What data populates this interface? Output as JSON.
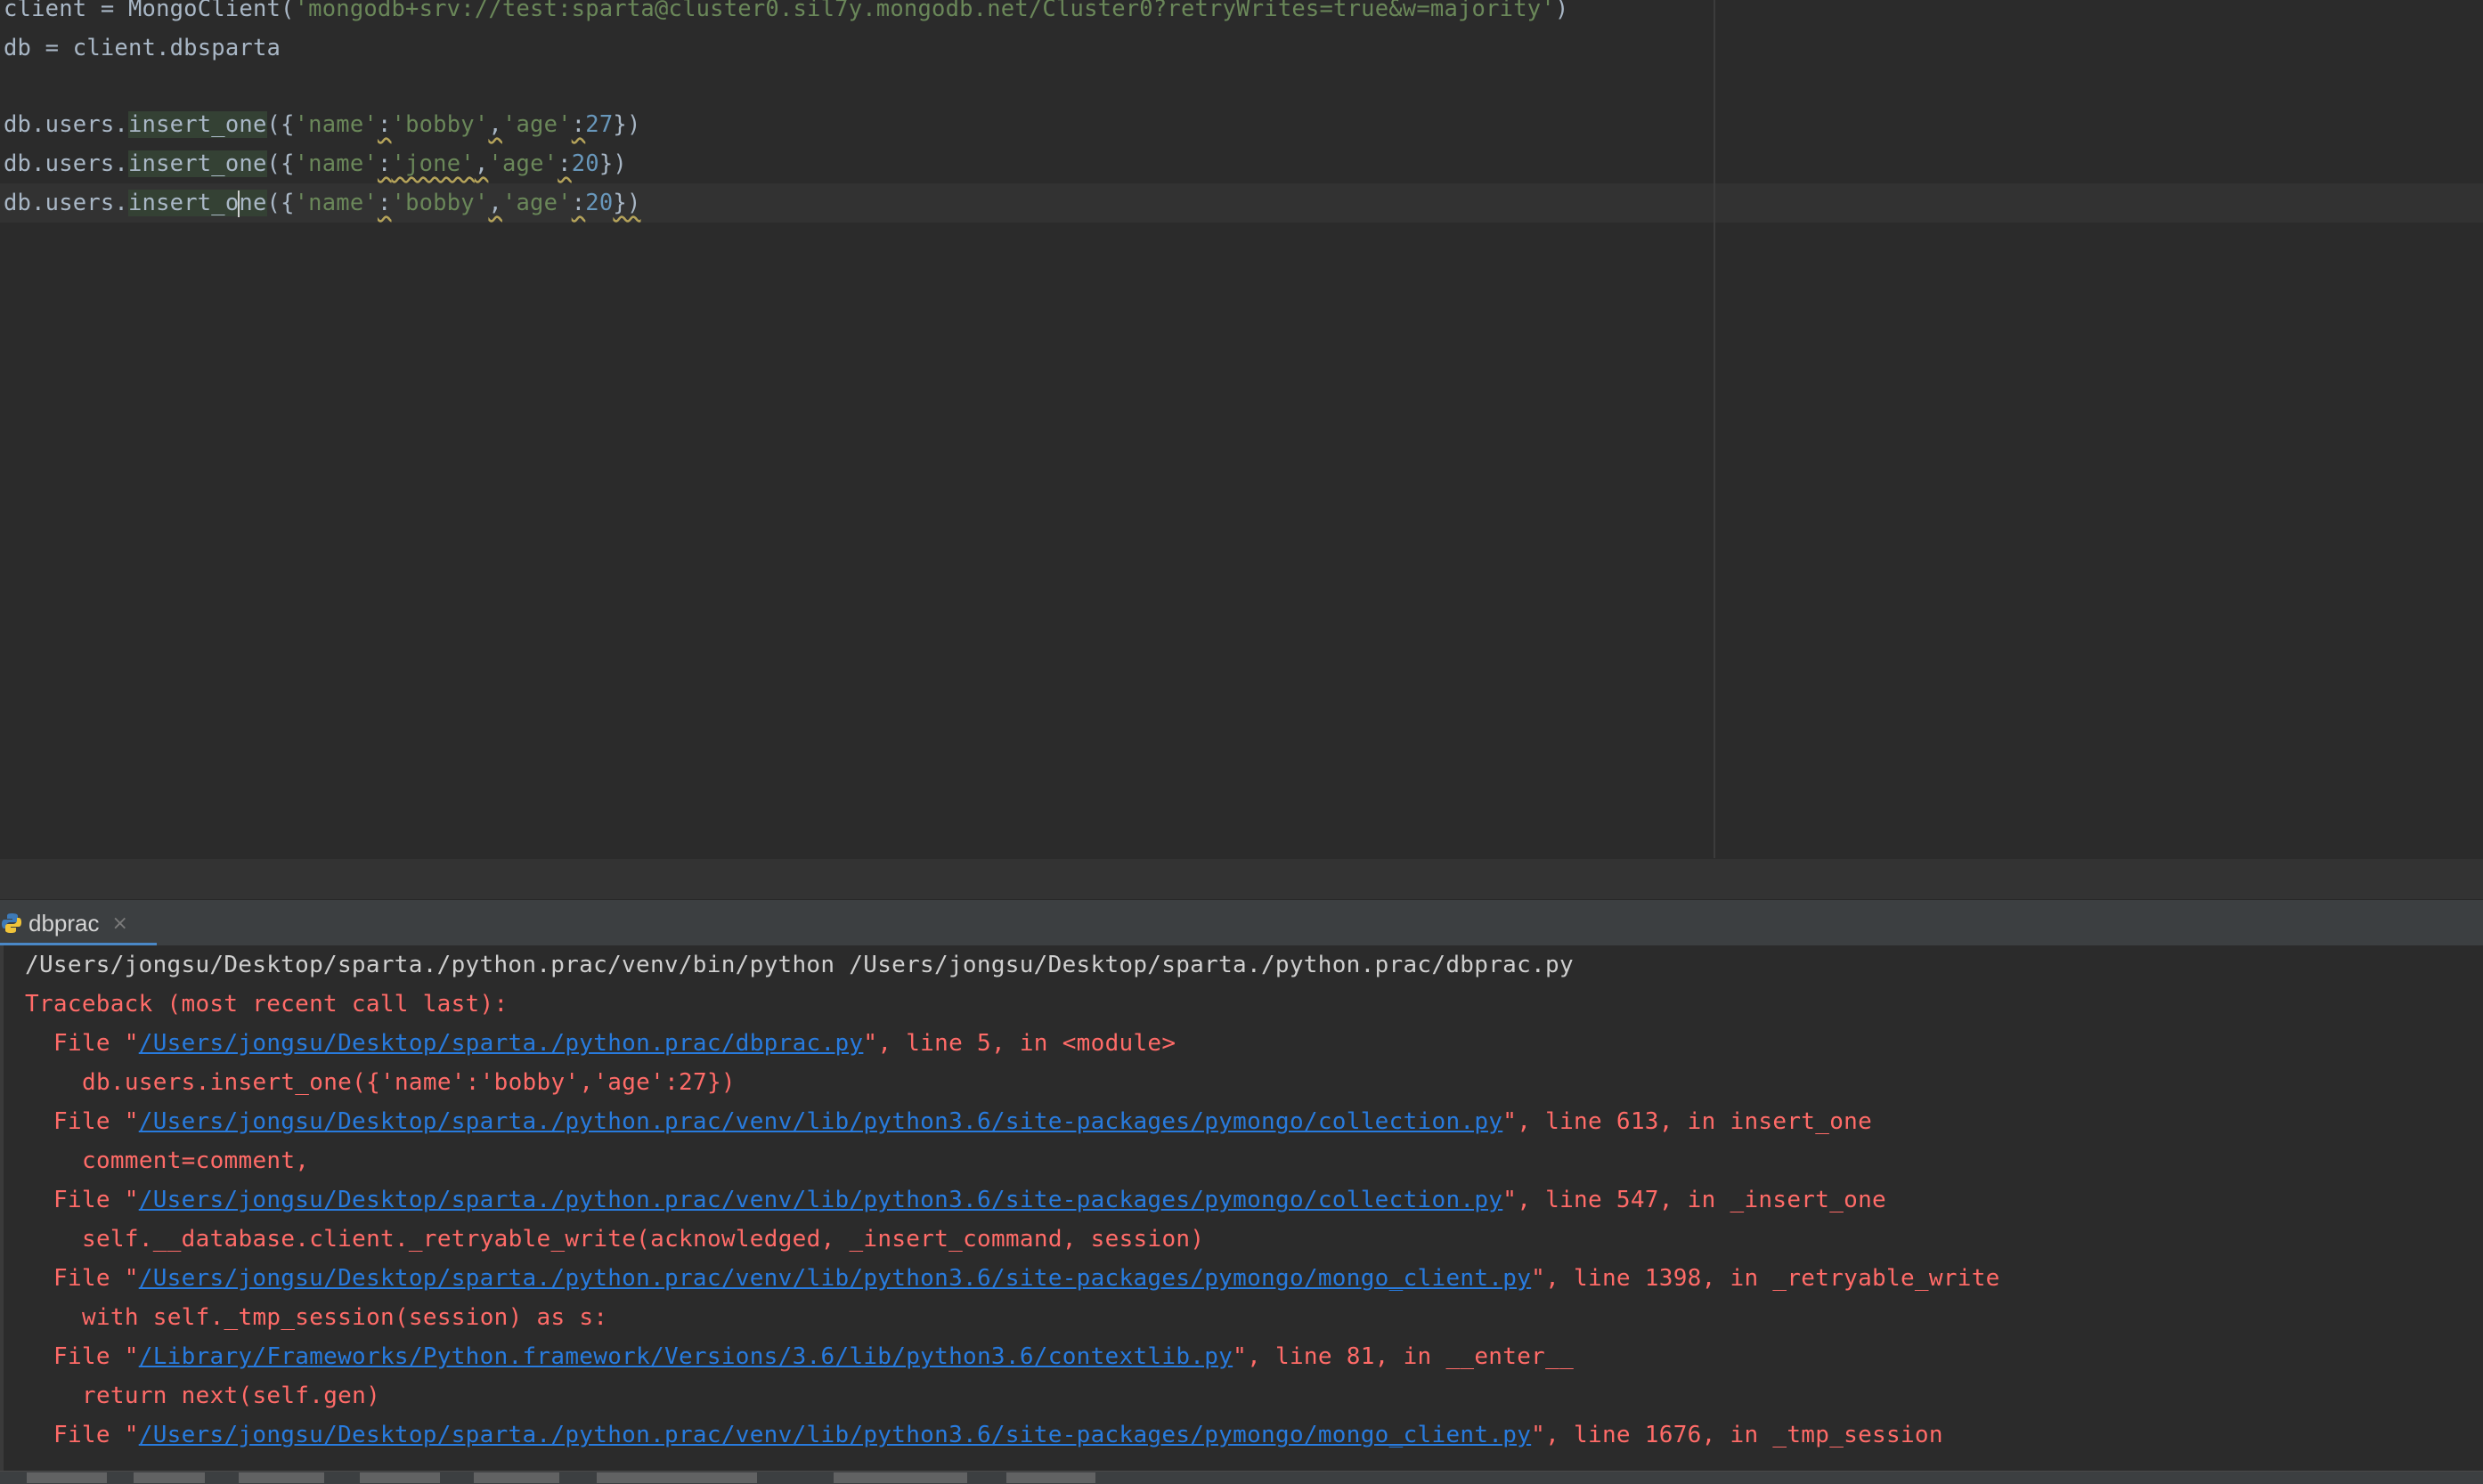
{
  "editor": {
    "line_client": {
      "pre": "client = MongoClient(",
      "str": "'mongodb+srv://test:sparta@cluster0.sil7y.mongodb.net/Cluster0?retryWrites=true&w=majority'",
      "post": ")"
    },
    "line_db": "db = client.dbsparta",
    "insert_lines": [
      {
        "prefix": "db.users.",
        "method": "insert_one",
        "open": "({",
        "k1": "'name'",
        "colon": ":",
        "v1": "'bobby'",
        "comma": ",",
        "k2": "'age'",
        "v2": "27",
        "close": "})"
      },
      {
        "prefix": "db.users.",
        "method": "insert_one",
        "open": "({",
        "k1": "'name'",
        "colon": ":",
        "v1": "'jone'",
        "comma": ",",
        "k2": "'age'",
        "v2": "20",
        "close": "})"
      },
      {
        "prefix": "db.users.",
        "method_a": "insert_o",
        "method_b": "ne",
        "open": "({",
        "k1": "'name'",
        "colon": ":",
        "v1": "'bobby'",
        "comma": ",",
        "k2": "'age'",
        "v2": "20",
        "close": "})"
      }
    ]
  },
  "run_tab": {
    "label": "dbprac",
    "close": "×"
  },
  "console": {
    "command": "/Users/jongsu/Desktop/sparta./python.prac/venv/bin/python /Users/jongsu/Desktop/sparta./python.prac/dbprac.py",
    "traceback_header": "Traceback (most recent call last):",
    "frames": [
      {
        "file_prefix": "File \"",
        "path": "/Users/jongsu/Desktop/sparta./python.prac/dbprac.py",
        "suffix": "\", line 5, in <module>",
        "code": "db.users.insert_one({'name':'bobby','age':27})"
      },
      {
        "file_prefix": "File \"",
        "path": "/Users/jongsu/Desktop/sparta./python.prac/venv/lib/python3.6/site-packages/pymongo/collection.py",
        "suffix": "\", line 613, in insert_one",
        "code": "comment=comment,"
      },
      {
        "file_prefix": "File \"",
        "path": "/Users/jongsu/Desktop/sparta./python.prac/venv/lib/python3.6/site-packages/pymongo/collection.py",
        "suffix": "\", line 547, in _insert_one",
        "code": "self.__database.client._retryable_write(acknowledged, _insert_command, session)"
      },
      {
        "file_prefix": "File \"",
        "path": "/Users/jongsu/Desktop/sparta./python.prac/venv/lib/python3.6/site-packages/pymongo/mongo_client.py",
        "suffix": "\", line 1398, in _retryable_write",
        "code": "with self._tmp_session(session) as s:"
      },
      {
        "file_prefix": "File \"",
        "path": "/Library/Frameworks/Python.framework/Versions/3.6/lib/python3.6/contextlib.py",
        "suffix": "\", line 81, in __enter__",
        "code": "return next(self.gen)"
      },
      {
        "file_prefix": "File \"",
        "path": "/Users/jongsu/Desktop/sparta./python.prac/venv/lib/python3.6/site-packages/pymongo/mongo_client.py",
        "suffix": "\", line 1676, in _tmp_session",
        "code": ""
      }
    ]
  },
  "colors": {
    "editor_bg": "#2b2b2b",
    "string": "#6a8759",
    "number": "#6897bb",
    "error": "#ff6b68",
    "link": "#287bde",
    "tab_accent": "#4a88c7"
  },
  "icons": {
    "run_tab_icon": "python-icon"
  }
}
